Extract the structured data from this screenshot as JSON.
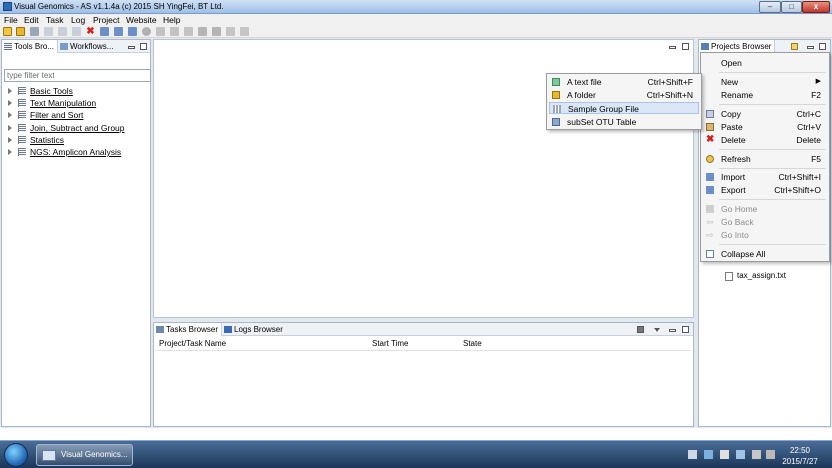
{
  "window": {
    "title": "Visual Genomics - AS v1.1.4a (c) 2015 SH YingFei, BT Ltd.",
    "min": "–",
    "max": "□",
    "close": "x"
  },
  "menubar": [
    "File",
    "Edit",
    "Task",
    "Log",
    "Project",
    "Website",
    "Help"
  ],
  "tools_panel": {
    "tabs": [
      "Tools Bro...",
      "Workflows..."
    ],
    "filter_placeholder": "type filter text",
    "items": [
      "Basic Tools",
      "Text Manipulation",
      "Filter and Sort",
      "Join, Subtract and Group",
      "Statistics",
      "NGS: Amplicon Analysis"
    ]
  },
  "tasks_panel": {
    "tabs": [
      "Tasks Browser",
      "Logs Browser"
    ],
    "columns": [
      "Project/Task Name",
      "Start Time",
      "State"
    ]
  },
  "projects_panel": {
    "tab": "Projects Browser",
    "files": [
      "tax_assign.txt"
    ]
  },
  "context_menu": [
    {
      "label": "Open",
      "shortcut": "",
      "icon": "",
      "disabled": false
    },
    {
      "label": "New",
      "shortcut": "",
      "icon": "",
      "disabled": false,
      "submenu": true
    },
    {
      "label": "Rename",
      "shortcut": "F2",
      "icon": "",
      "disabled": false
    },
    {
      "label": "Copy",
      "shortcut": "Ctrl+C",
      "icon": "copy-icon",
      "disabled": false
    },
    {
      "label": "Paste",
      "shortcut": "Ctrl+V",
      "icon": "paste-icon",
      "disabled": false
    },
    {
      "label": "Delete",
      "shortcut": "Delete",
      "icon": "delete-icon",
      "disabled": false
    },
    {
      "label": "Refresh",
      "shortcut": "F5",
      "icon": "refresh-icon",
      "disabled": false
    },
    {
      "label": "Import",
      "shortcut": "Ctrl+Shift+I",
      "icon": "import-icon",
      "disabled": false
    },
    {
      "label": "Export",
      "shortcut": "Ctrl+Shift+O",
      "icon": "export-icon",
      "disabled": false
    },
    {
      "label": "Go Home",
      "shortcut": "",
      "icon": "home-icon",
      "disabled": true
    },
    {
      "label": "Go Back",
      "shortcut": "",
      "icon": "back-icon",
      "disabled": true
    },
    {
      "label": "Go Into",
      "shortcut": "",
      "icon": "go-into-icon",
      "disabled": true
    },
    {
      "label": "Collapse All",
      "shortcut": "",
      "icon": "collapse-all-icon",
      "disabled": false
    }
  ],
  "submenu": [
    {
      "label": "A text file",
      "shortcut": "Ctrl+Shift+F",
      "icon": "text-file-icon"
    },
    {
      "label": "A folder",
      "shortcut": "Ctrl+Shift+N",
      "icon": "folder-icon"
    },
    {
      "label": "Sample Group File",
      "shortcut": "",
      "icon": "sample-group-icon",
      "highlighted": true
    },
    {
      "label": "subSet OTU Table",
      "shortcut": "",
      "icon": "table-icon"
    }
  ],
  "taskbar": {
    "app_label": "Visual Genomics...",
    "time": "22:50",
    "date": "2015/7/27"
  },
  "colors": {
    "titlebar": "#9fbfe6",
    "close_button": "#c0392b",
    "workarea": "#e3e7ee",
    "menu_highlight": "#dbe7f7",
    "taskbar": "#1c3659"
  }
}
